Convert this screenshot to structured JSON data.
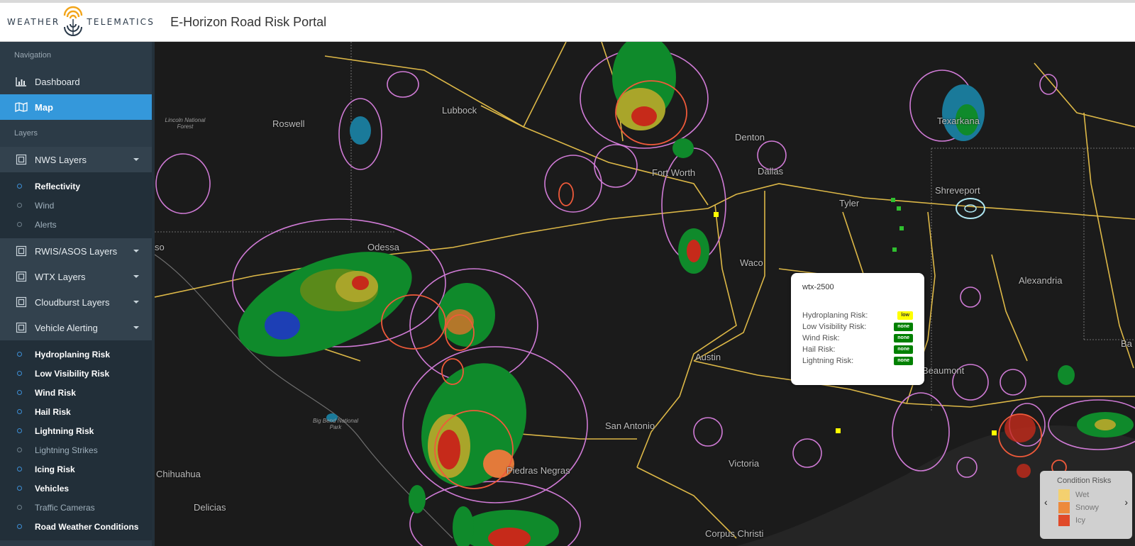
{
  "header": {
    "logo_left": "WEATHER",
    "logo_right": "TELEMATICS",
    "title": "E-Horizon Road Risk Portal"
  },
  "sidebar": {
    "nav_label": "Navigation",
    "dashboard": "Dashboard",
    "map": "Map",
    "layers_label": "Layers",
    "nws": {
      "label": "NWS Layers",
      "items": [
        {
          "label": "Reflectivity",
          "on": true
        },
        {
          "label": "Wind",
          "on": false
        },
        {
          "label": "Alerts",
          "on": false
        }
      ]
    },
    "rwis": "RWIS/ASOS Layers",
    "wtx": "WTX Layers",
    "cloudburst": "Cloudburst Layers",
    "vehicle": {
      "label": "Vehicle Alerting",
      "items": [
        {
          "label": "Hydroplaning Risk",
          "on": true
        },
        {
          "label": "Low Visibility Risk",
          "on": true
        },
        {
          "label": "Wind Risk",
          "on": true
        },
        {
          "label": "Hail Risk",
          "on": true
        },
        {
          "label": "Lightning Risk",
          "on": true
        },
        {
          "label": "Lightning Strikes",
          "on": false
        },
        {
          "label": "Icing Risk",
          "on": true
        },
        {
          "label": "Vehicles",
          "on": true
        },
        {
          "label": "Traffic Cameras",
          "on": false
        },
        {
          "label": "Road Weather Conditions",
          "on": true
        }
      ]
    }
  },
  "map": {
    "cities": [
      {
        "name": "Roswell"
      },
      {
        "name": "Lubbock"
      },
      {
        "name": "Denton"
      },
      {
        "name": "Fort Worth"
      },
      {
        "name": "Dallas"
      },
      {
        "name": "Tyler"
      },
      {
        "name": "Texarkana"
      },
      {
        "name": "Shreveport"
      },
      {
        "name": "Waco"
      },
      {
        "name": "Odessa"
      },
      {
        "name": "Austin"
      },
      {
        "name": "San Antonio"
      },
      {
        "name": "Victoria"
      },
      {
        "name": "Beaumont"
      },
      {
        "name": "Alexandria"
      },
      {
        "name": "Chihuahua"
      },
      {
        "name": "Delicias"
      },
      {
        "name": "Piedras Negras"
      },
      {
        "name": "Corpus Christi"
      }
    ],
    "parks": {
      "lincoln": "Lincoln National Forest",
      "bigbend": "Big Bend National Park"
    },
    "edge_labels": {
      "left": "so",
      "right": "Ba"
    }
  },
  "popup": {
    "title": "wtx-2500",
    "rows": [
      {
        "label": "Hydroplaning Risk:",
        "value": "low",
        "level": "low"
      },
      {
        "label": "Low Visibility Risk:",
        "value": "none",
        "level": "none"
      },
      {
        "label": "Wind Risk:",
        "value": "none",
        "level": "none"
      },
      {
        "label": "Hail Risk:",
        "value": "none",
        "level": "none"
      },
      {
        "label": "Lightning Risk:",
        "value": "none",
        "level": "none"
      }
    ]
  },
  "legend": {
    "title": "Condition Risks",
    "items": [
      {
        "label": "Wet",
        "color": "#f4d06f"
      },
      {
        "label": "Snowy",
        "color": "#ed8a3c"
      },
      {
        "label": "Icy",
        "color": "#e04a2a"
      }
    ]
  },
  "colors": {
    "accent": "#3498db",
    "sidebar": "#2c3b47",
    "road": "#f2c94c"
  }
}
